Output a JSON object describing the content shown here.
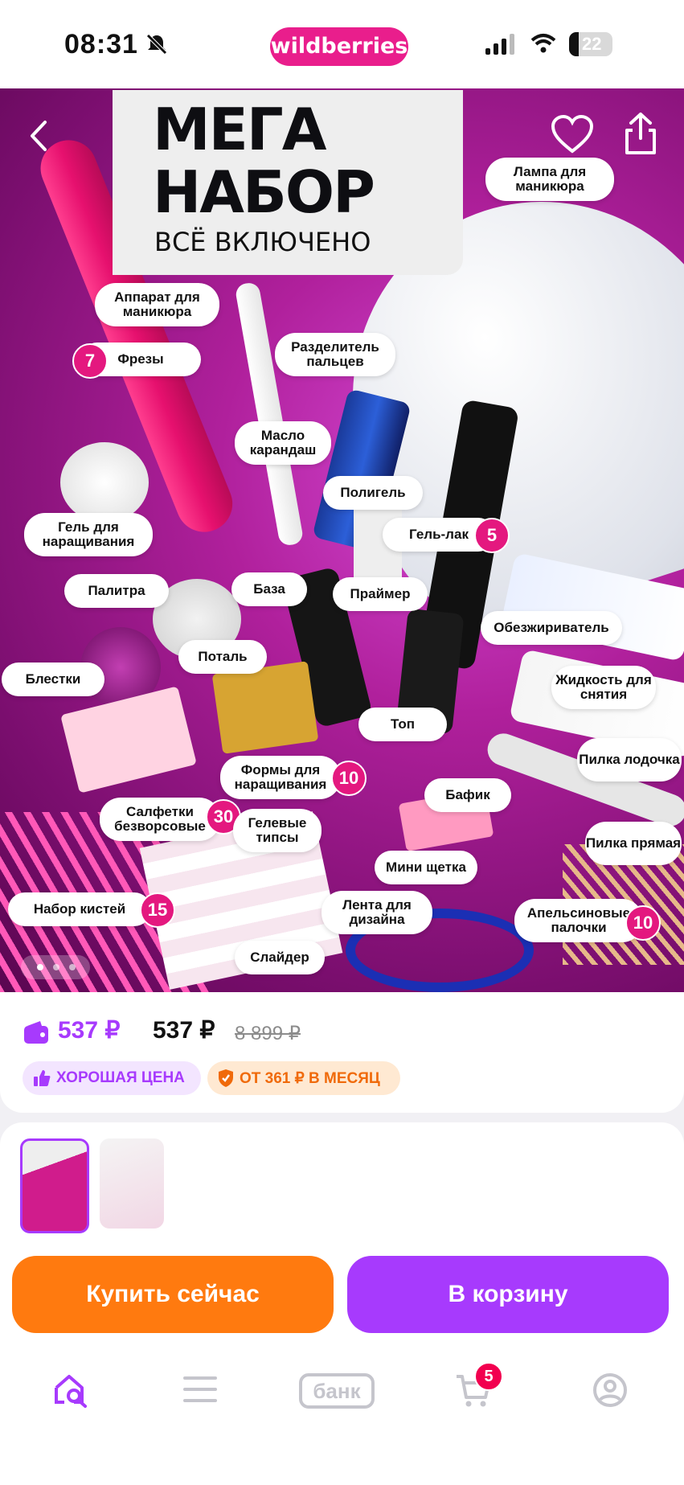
{
  "status_bar": {
    "time": "08:31",
    "brand": "wildberries",
    "battery": "22"
  },
  "hero": {
    "title_line1": "МЕГА",
    "title_line2": "НАБОР",
    "subtitle": "ВСЁ ВКЛЮЧЕНО",
    "labels": {
      "lamp": "Лампа для маникюра",
      "device": "Аппарат для маникюра",
      "mills": "Фрезы",
      "separator": "Разделитель пальцев",
      "oil": "Масло карандаш",
      "polygel": "Полигель",
      "gel_polish": "Гель-лак",
      "extension_gel": "Гель для наращивания",
      "palette": "Палитра",
      "base": "База",
      "primer": "Праймер",
      "degreaser": "Обезжириватель",
      "foil": "Поталь",
      "glitter": "Блестки",
      "remover": "Жидкость для снятия",
      "top": "Топ",
      "boat_file": "Пилка лодочка",
      "forms": "Формы для наращивания",
      "buffer": "Бафик",
      "wipes": "Салфетки безворсовые",
      "gel_tips": "Гелевые типсы",
      "straight_file": "Пилка прямая",
      "mini_brush": "Мини щетка",
      "brush_set": "Набор кистей",
      "tape": "Лента для дизайна",
      "orange_sticks": "Апельсиновые палочки",
      "slider": "Слайдер"
    },
    "counts": {
      "mills": "7",
      "gel_polish": "5",
      "forms": "10",
      "wipes": "30",
      "brush_set": "15",
      "orange_sticks": "10"
    }
  },
  "price": {
    "wallet_price": "537 ₽",
    "current": "537 ₽",
    "old": "8 899 ₽",
    "badge_good": "ХОРОШАЯ ЦЕНА",
    "badge_month": "ОТ 361 ₽ В МЕСЯЦ"
  },
  "actions": {
    "buy_now": "Купить сейчас",
    "add_to_cart": "В корзину"
  },
  "tabbar": {
    "bank": "банк",
    "cart_count": "5"
  },
  "colors": {
    "accent": "#a73afd",
    "brand": "#e91e8c",
    "buy": "#ff7a0f",
    "badge": "#f2004f"
  }
}
